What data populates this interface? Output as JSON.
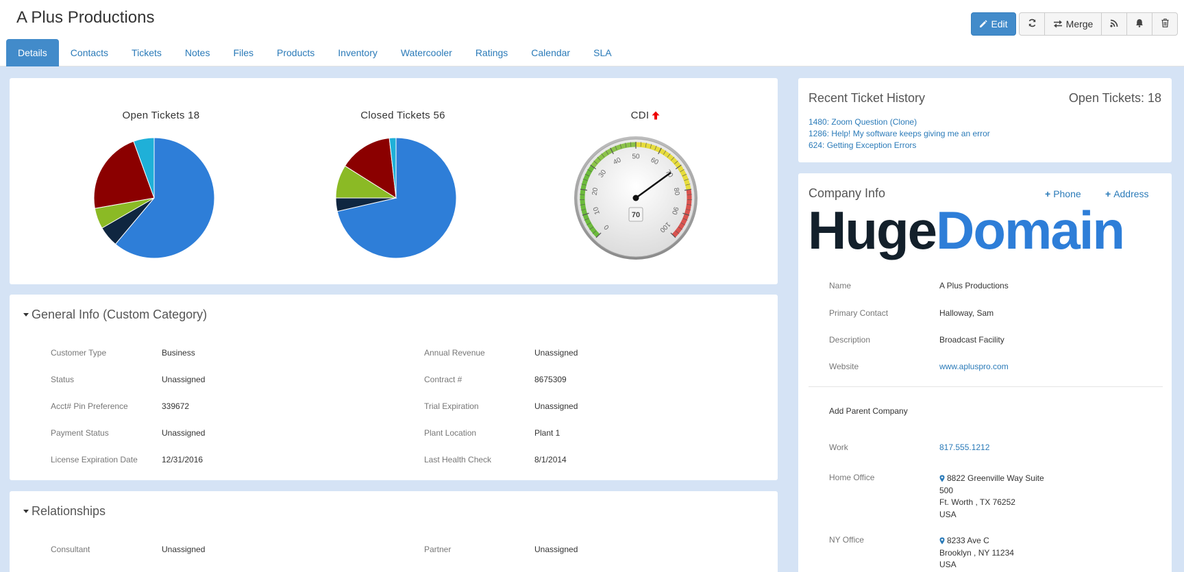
{
  "header": {
    "title": "A Plus Productions"
  },
  "toolbar": {
    "edit_label": "Edit",
    "merge_label": "Merge"
  },
  "tabs": [
    {
      "label": "Details"
    },
    {
      "label": "Contacts"
    },
    {
      "label": "Tickets"
    },
    {
      "label": "Notes"
    },
    {
      "label": "Files"
    },
    {
      "label": "Products"
    },
    {
      "label": "Inventory"
    },
    {
      "label": "Watercooler"
    },
    {
      "label": "Ratings"
    },
    {
      "label": "Calendar"
    },
    {
      "label": "SLA"
    }
  ],
  "colors": {
    "accent": "#428bca",
    "link": "#2a7ab8",
    "pie_blue": "#2e7ed8",
    "pie_navy": "#0f2640",
    "pie_green": "#8bba25",
    "pie_red": "#8b0000",
    "pie_cyan": "#1fb0d8"
  },
  "chart_data": [
    {
      "type": "pie",
      "title": "Open Tickets 18",
      "slices": [
        {
          "color": "#2e7ed8",
          "value": 11
        },
        {
          "color": "#0f2640",
          "value": 1
        },
        {
          "color": "#8bba25",
          "value": 1
        },
        {
          "color": "#8b0000",
          "value": 4
        },
        {
          "color": "#1fb0d8",
          "value": 1
        }
      ]
    },
    {
      "type": "pie",
      "title": "Closed Tickets 56",
      "slices": [
        {
          "color": "#2e7ed8",
          "value": 40
        },
        {
          "color": "#0f2640",
          "value": 2
        },
        {
          "color": "#8bba25",
          "value": 5
        },
        {
          "color": "#8b0000",
          "value": 8
        },
        {
          "color": "#1fb0d8",
          "value": 1
        }
      ]
    },
    {
      "type": "gauge",
      "title": "CDI",
      "value": 70,
      "min": 0,
      "max": 100,
      "ticks": [
        "0",
        "10",
        "20",
        "30",
        "40",
        "50",
        "60",
        "70",
        "80",
        "90",
        "100"
      ]
    }
  ],
  "general_info": {
    "title": "General Info (Custom Category)",
    "left": [
      {
        "label": "Customer Type",
        "value": "Business"
      },
      {
        "label": "Status",
        "value": "Unassigned"
      },
      {
        "label": "Acct# Pin Preference",
        "value": "339672"
      },
      {
        "label": "Payment Status",
        "value": "Unassigned"
      },
      {
        "label": "License Expiration Date",
        "value": "12/31/2016"
      }
    ],
    "right": [
      {
        "label": "Annual Revenue",
        "value": "Unassigned"
      },
      {
        "label": "Contract #",
        "value": "8675309"
      },
      {
        "label": "Trial Expiration",
        "value": "Unassigned"
      },
      {
        "label": "Plant Location",
        "value": "Plant 1"
      },
      {
        "label": "Last Health Check",
        "value": "8/1/2014"
      }
    ]
  },
  "relationships": {
    "title": "Relationships",
    "left": [
      {
        "label": "Consultant",
        "value": "Unassigned"
      }
    ],
    "right": [
      {
        "label": "Partner",
        "value": "Unassigned"
      }
    ]
  },
  "ticket_history": {
    "title": "Recent Ticket History",
    "open_label": "Open Tickets: 18",
    "items": [
      "1480: Zoom Question (Clone)",
      "1286: Help! My software keeps giving me an error",
      "624: Getting Exception Errors"
    ]
  },
  "company": {
    "title": "Company Info",
    "phone_label": "Phone",
    "address_label": "Address",
    "logo_part1": "Huge",
    "logo_part2": "Domain",
    "fields": [
      {
        "label": "Name",
        "value": "A Plus Productions"
      },
      {
        "label": "Primary Contact",
        "value": "Halloway, Sam"
      },
      {
        "label": "Description",
        "value": "Broadcast Facility"
      },
      {
        "label": "Website",
        "value": "www.apluspro.com"
      }
    ],
    "add_parent": "Add Parent Company",
    "work_label": "Work",
    "work_value": "817.555.1212",
    "home_label": "Home Office",
    "home_line1": "8822 Greenville Way Suite",
    "home_line2": "500",
    "home_line3": "Ft. Worth , TX 76252",
    "home_line4": "USA",
    "ny_label": "NY Office",
    "ny_line1": "8233 Ave C",
    "ny_line2": "Brooklyn , NY 11234",
    "ny_line3": "USA"
  }
}
